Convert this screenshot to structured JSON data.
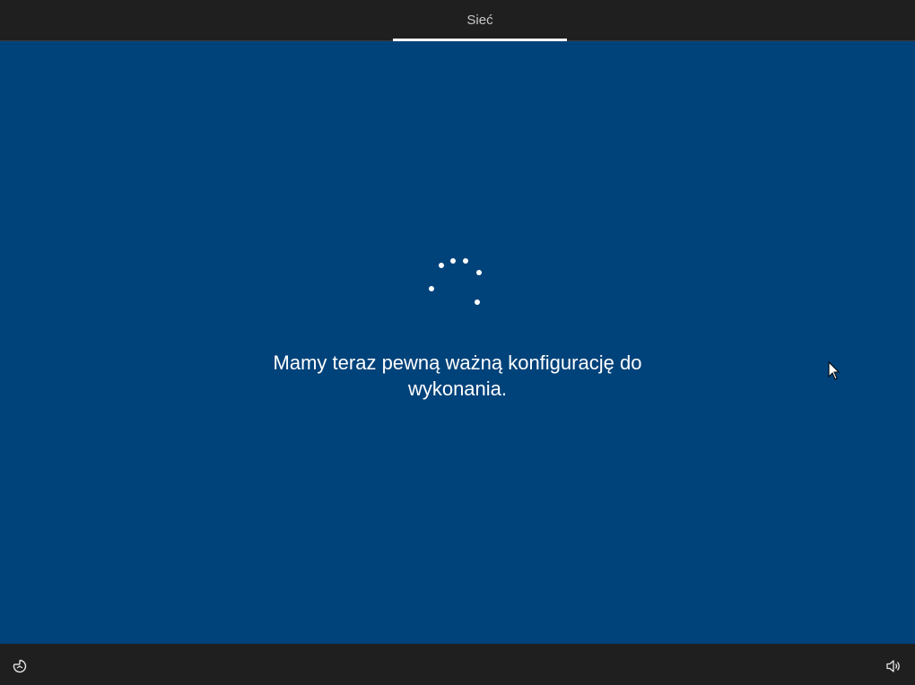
{
  "header": {
    "active_tab_label": "Sieć"
  },
  "main": {
    "message": "Mamy teraz pewną ważną konfigurację do wykonania.",
    "spinner_icon": "loading-dots-icon"
  },
  "footer": {
    "left_icon": "ease-of-access-icon",
    "right_icon": "volume-icon"
  },
  "colors": {
    "background": "#00427a",
    "bar": "#1f1f1f",
    "text": "#ffffff",
    "tab_text": "#c8c8c8"
  }
}
